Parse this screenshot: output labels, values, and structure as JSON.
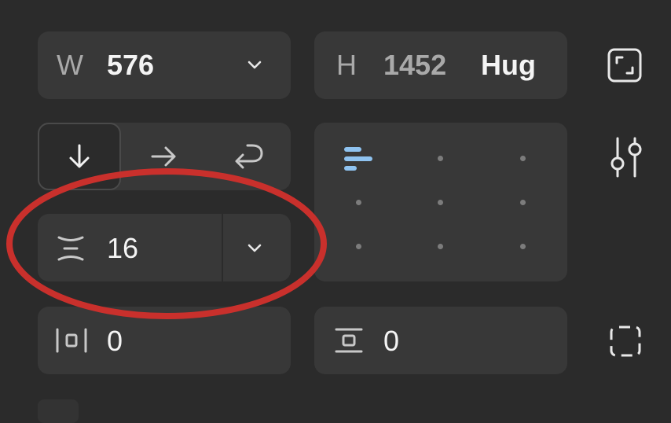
{
  "width": {
    "label": "W",
    "value": "576"
  },
  "height": {
    "label": "H",
    "value": "1452",
    "mode": "Hug"
  },
  "direction": {
    "options": [
      {
        "name": "vertical",
        "active": true
      },
      {
        "name": "horizontal",
        "active": false
      },
      {
        "name": "wrap",
        "active": false
      }
    ]
  },
  "gap": {
    "value": "16"
  },
  "padding_horizontal": {
    "value": "0"
  },
  "padding_vertical": {
    "value": "0"
  },
  "alignment": {
    "selected": "top-left"
  },
  "colors": {
    "background": "#2b2b2b",
    "field": "#383838",
    "accent": "#8fc3f0",
    "annotation": "#c9302c"
  },
  "icons": {
    "resize": "resize-corners-icon",
    "settings": "sliders-icon",
    "padding": "padding-box-icon"
  }
}
